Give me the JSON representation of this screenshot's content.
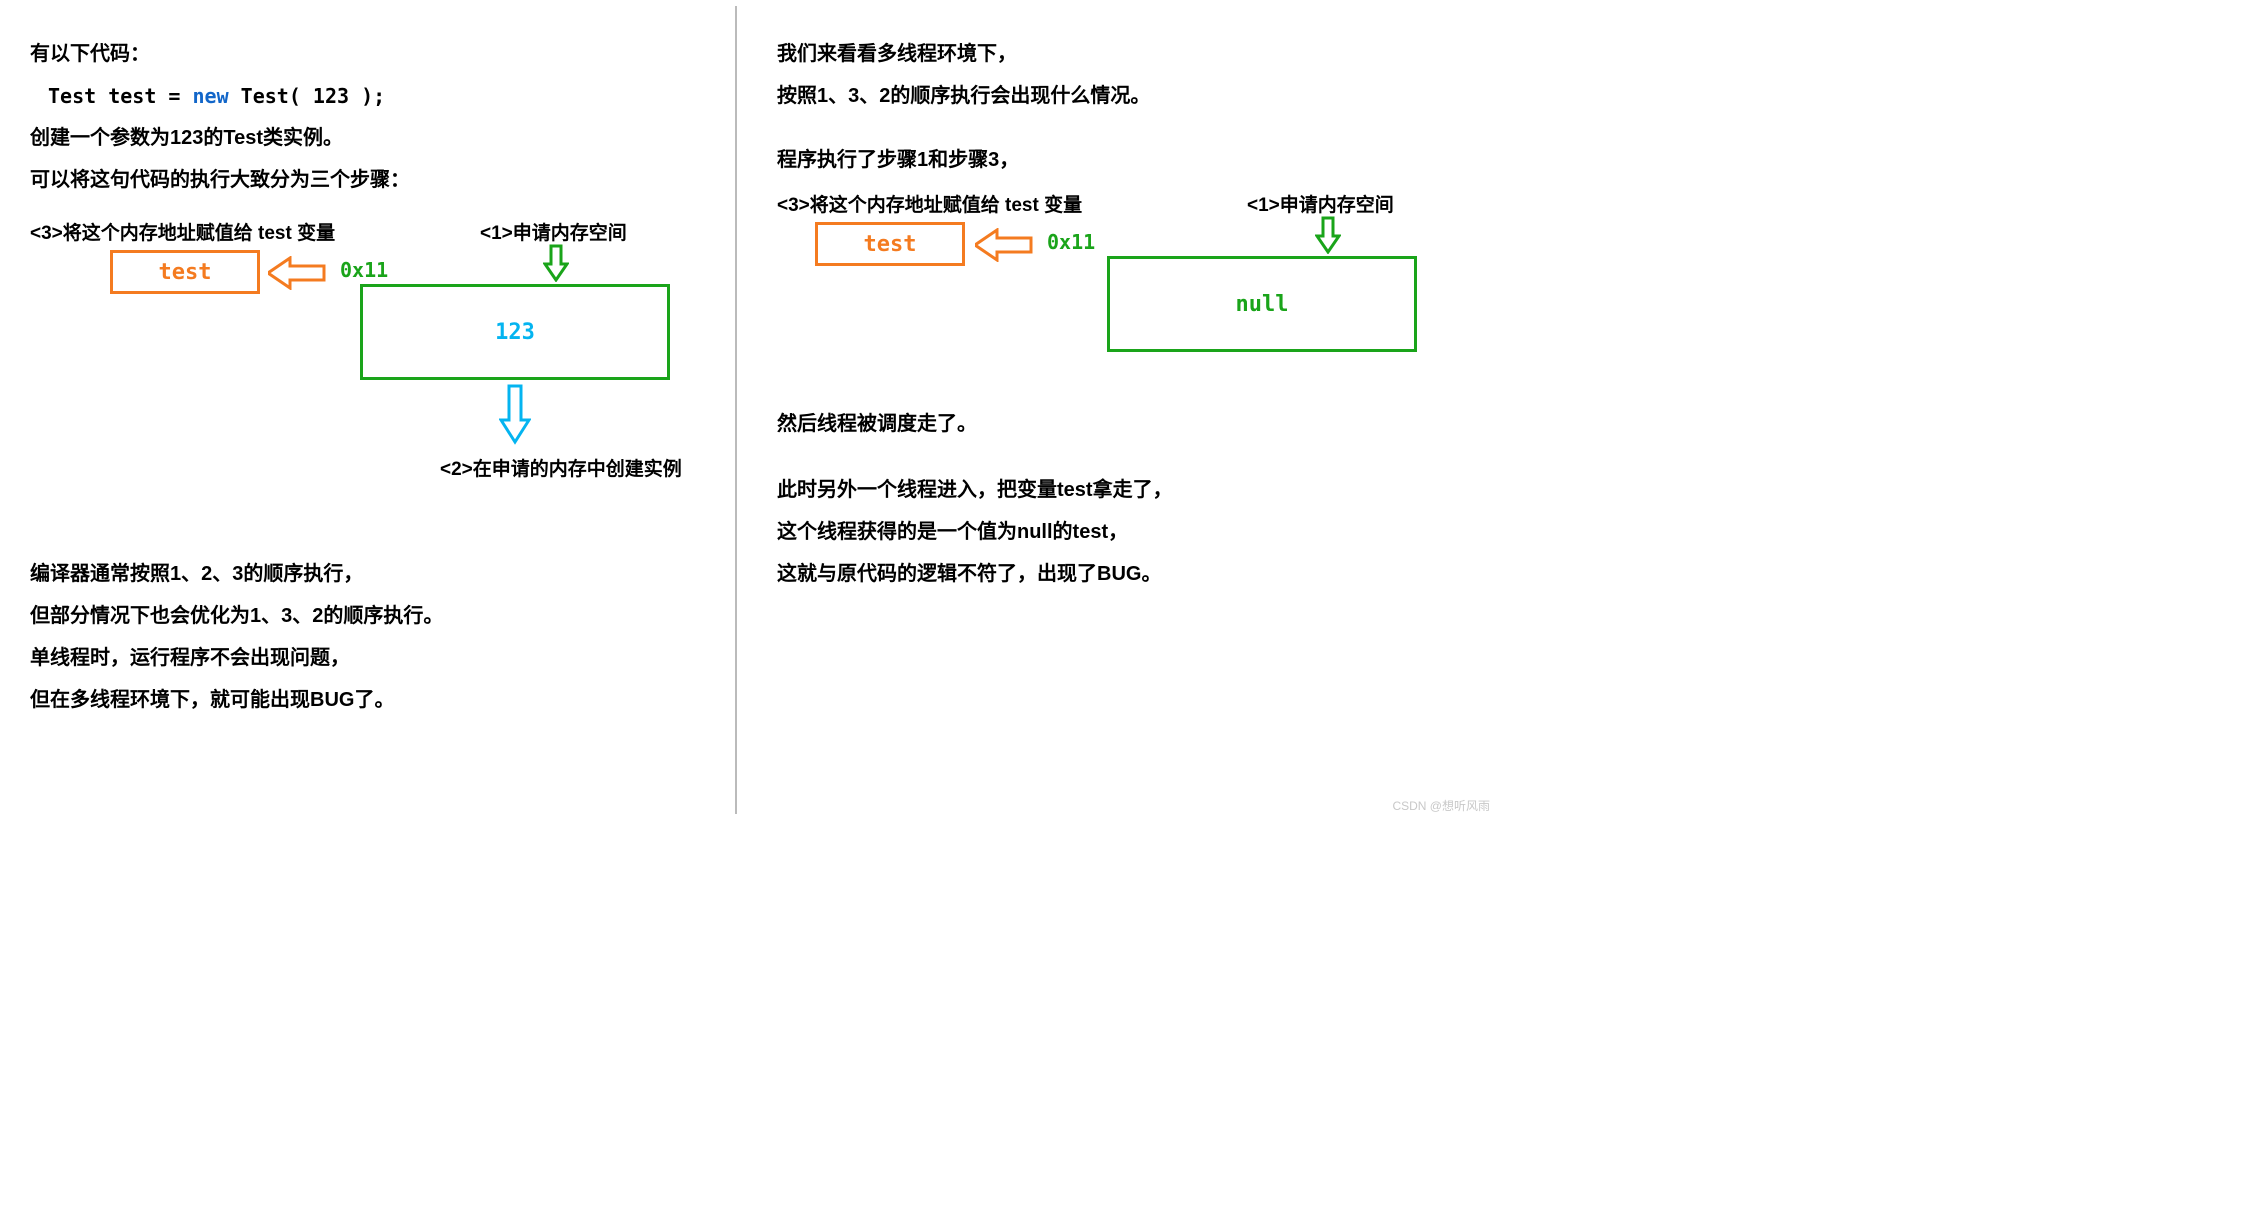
{
  "left": {
    "intro1": "有以下代码：",
    "code": {
      "a": "Test test = ",
      "kw": "new",
      "b": " Test( 123 );"
    },
    "intro2": "创建一个参数为123的Test类实例。",
    "intro3": "可以将这句代码的执行大致分为三个步骤：",
    "step3": "<3>将这个内存地址赋值给 test 变量",
    "step1": "<1>申请内存空间",
    "step2": "<2>在申请的内存中创建实例",
    "testbox": "test",
    "addr": "0x11",
    "memval": "123",
    "p1": "编译器通常按照1、2、3的顺序执行，",
    "p2": "但部分情况下也会优化为1、3、2的顺序执行。",
    "p3": "单线程时，运行程序不会出现问题，",
    "p4": "但在多线程环境下，就可能出现BUG了。"
  },
  "right": {
    "r1": "我们来看看多线程环境下，",
    "r2": "按照1、3、2的顺序执行会出现什么情况。",
    "r3": "程序执行了步骤1和步骤3，",
    "step3": "<3>将这个内存地址赋值给 test 变量",
    "step1": "<1>申请内存空间",
    "testbox": "test",
    "addr": "0x11",
    "memval": "null",
    "r4": "然后线程被调度走了。",
    "r5": "此时另外一个线程进入，把变量test拿走了，",
    "r6": "这个线程获得的是一个值为null的test，",
    "r7": "这就与原代码的逻辑不符了，出现了BUG。"
  },
  "watermark": "CSDN @想听风雨",
  "colors": {
    "orange": "#f47b20",
    "green": "#1aa41a",
    "blue": "#04b4f0"
  }
}
